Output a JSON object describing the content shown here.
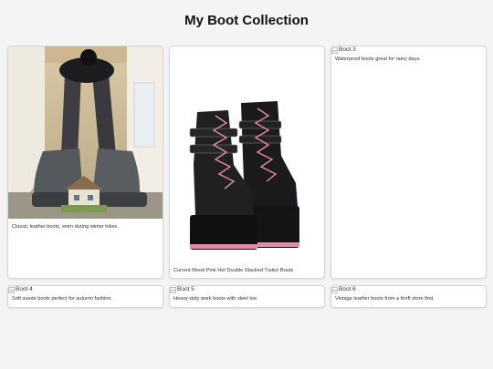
{
  "page": {
    "title": "My Boot Collection"
  },
  "cards": [
    {
      "image_alt": "",
      "caption": "Classic leather boots, worn during winter hikes."
    },
    {
      "image_alt": "",
      "caption": "Current Mood Pink Hot Double Stacked Traitor Boots"
    },
    {
      "image_alt": "Boot 3",
      "caption": "Waterproof boots great for rainy days."
    },
    {
      "image_alt": "Boot 4",
      "caption": "Soft suede boots perfect for autumn fashion."
    },
    {
      "image_alt": "Boot 5",
      "caption": "Heavy-duty work boots with steel toe."
    },
    {
      "image_alt": "Boot 6",
      "caption": "Vintage leather boots from a thrift store find."
    }
  ],
  "icons": {
    "broken_image": "broken-image-icon"
  }
}
